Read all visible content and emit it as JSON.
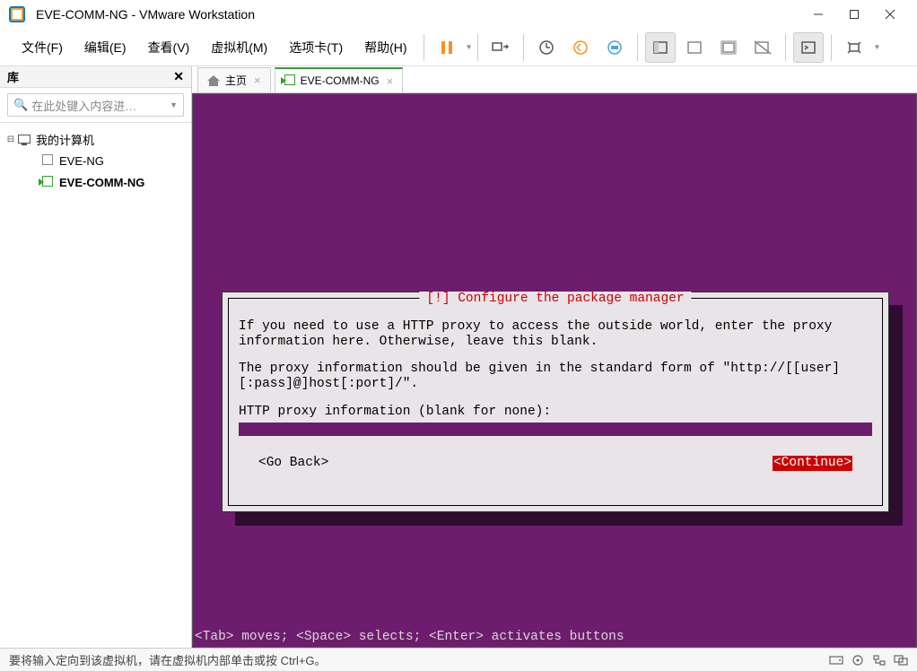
{
  "window": {
    "title": "EVE-COMM-NG - VMware Workstation"
  },
  "menu": {
    "file": "文件(F)",
    "edit": "编辑(E)",
    "view": "查看(V)",
    "vm": "虚拟机(M)",
    "tabs": "选项卡(T)",
    "help": "帮助(H)"
  },
  "sidebar": {
    "header": "库",
    "search_placeholder": "在此处键入内容进…",
    "root": "我的计算机",
    "items": [
      "EVE-NG",
      "EVE-COMM-NG"
    ]
  },
  "tabs": {
    "home": "主页",
    "vm": "EVE-COMM-NG"
  },
  "installer": {
    "title": "[!] Configure the package manager",
    "p1": "If you need to use a HTTP proxy to access the outside world, enter the proxy information here. Otherwise, leave this blank.",
    "p2": "The proxy information should be given in the standard form of \"http://[[user][:pass]@]host[:port]/\".",
    "p3": "HTTP proxy information (blank for none):",
    "back": "<Go Back>",
    "cont": "<Continue>",
    "hint": "<Tab> moves; <Space> selects; <Enter> activates buttons"
  },
  "status": {
    "text": "要将输入定向到该虚拟机，请在虚拟机内部单击或按 Ctrl+G。"
  }
}
